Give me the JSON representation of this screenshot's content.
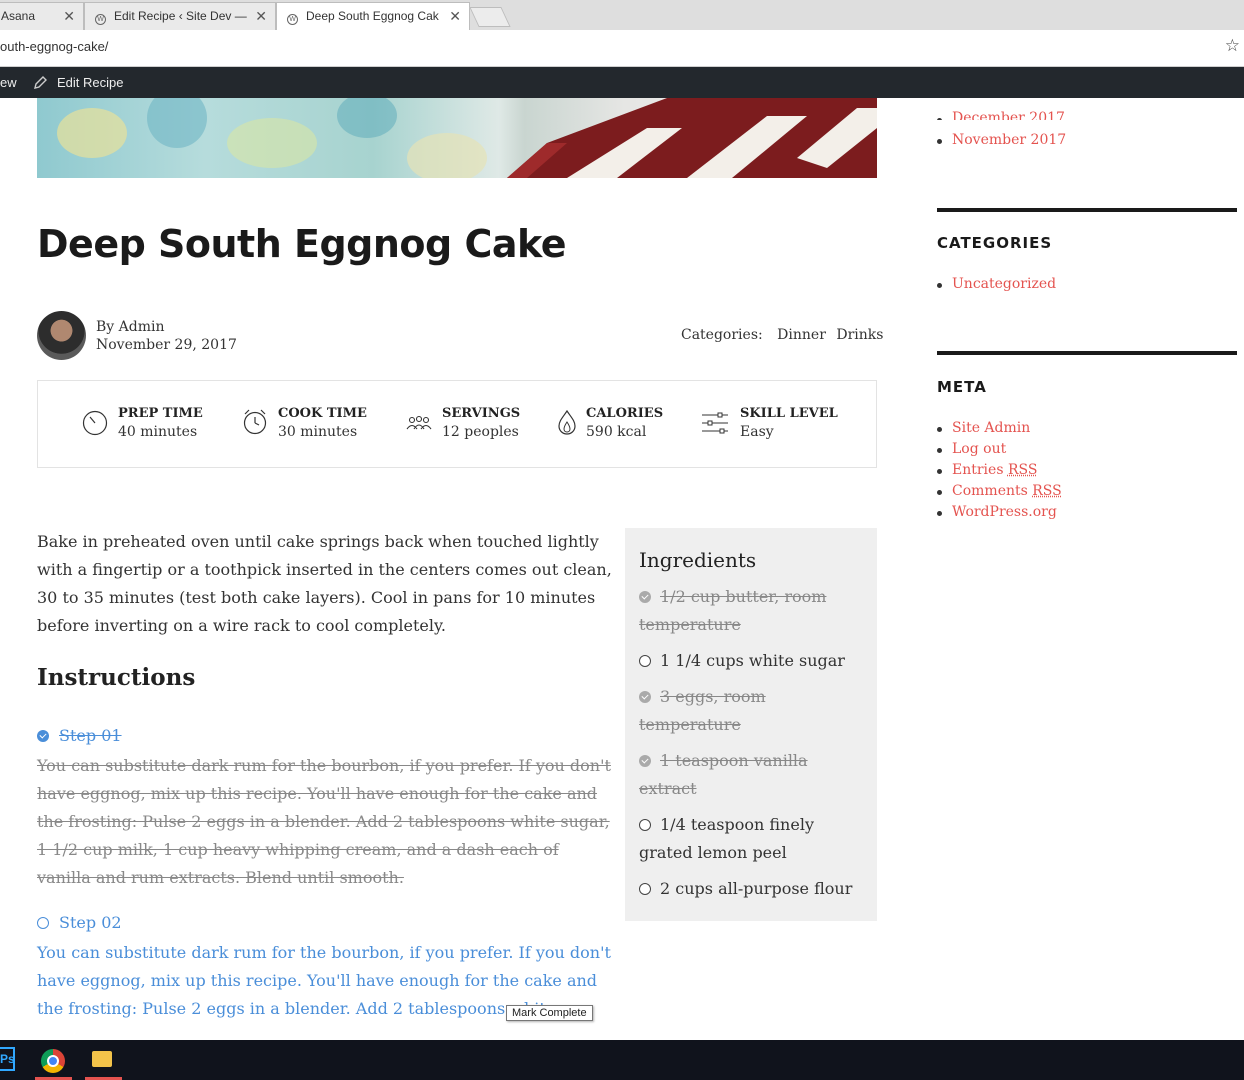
{
  "browser": {
    "tabs": [
      {
        "label": "Asana",
        "close": "✕"
      },
      {
        "label": "Edit Recipe ‹ Site Dev —",
        "close": "✕"
      },
      {
        "label": "Deep South Eggnog Cak",
        "close": "✕"
      }
    ],
    "url": "outh-eggnog-cake/",
    "star": "☆"
  },
  "adminbar": {
    "view_label": "ew",
    "edit_label": "Edit Recipe"
  },
  "post": {
    "title": "Deep South Eggnog Cake",
    "author": "By Admin",
    "date": "November 29, 2017",
    "categories_label": "Categories:",
    "categories": [
      "Dinner",
      "Drinks"
    ]
  },
  "info": [
    {
      "label": "PREP TIME",
      "value": "40 minutes",
      "icon": "timer-icon"
    },
    {
      "label": "COOK TIME",
      "value": "30 minutes",
      "icon": "alarm-clock-icon"
    },
    {
      "label": "SERVINGS",
      "value": "12 peoples",
      "icon": "people-icon"
    },
    {
      "label": "CALORIES",
      "value": "590 kcal",
      "icon": "flame-icon"
    },
    {
      "label": "SKILL LEVEL",
      "value": "Easy",
      "icon": "sliders-icon"
    }
  ],
  "intro": "Bake in preheated oven until cake springs back when touched lightly with a fingertip or a toothpick inserted in the centers comes out clean, 30 to 35 minutes (test both cake layers). Cool in pans for 10 minutes before inverting on a wire rack to cool completely.",
  "instructions": {
    "heading": "Instructions",
    "steps": [
      {
        "label": "Step 01",
        "completed": true,
        "text": "You can substitute dark rum for the bourbon, if you prefer. If you don't have eggnog, mix up this recipe. You'll have enough for the cake and the frosting: Pulse 2 eggs in a blender. Add 2 tablespoons white sugar, 1 1/2 cup milk, 1 cup heavy whipping cream, and a dash each of vanilla and rum extracts. Blend until smooth."
      },
      {
        "label": "Step 02",
        "completed": false,
        "text": "You can substitute dark rum for the bourbon, if you prefer. If you don't have eggnog, mix up this recipe. You'll have enough for the cake and the frosting: Pulse 2 eggs in a blender. Add 2 tablespoons white"
      }
    ],
    "tooltip": "Mark Complete"
  },
  "ingredients": {
    "heading": "Ingredients",
    "items": [
      {
        "text": "1/2 cup butter, room temperature",
        "completed": true
      },
      {
        "text": "1 1/4 cups white sugar",
        "completed": false
      },
      {
        "text": "3 eggs, room temperature",
        "completed": true
      },
      {
        "text": "1 teaspoon vanilla extract",
        "completed": true
      },
      {
        "text": "1/4 teaspoon finely grated lemon peel",
        "completed": false
      },
      {
        "text": "2 cups all-purpose flour",
        "completed": false
      }
    ]
  },
  "sidebar": {
    "archives": [
      "December 2017",
      "November 2017"
    ],
    "categories_heading": "CATEGORIES",
    "categories": [
      "Uncategorized"
    ],
    "meta_heading": "META",
    "meta": [
      {
        "text": "Site Admin"
      },
      {
        "text": "Log out"
      },
      {
        "text": "Entries ",
        "abbr": "RSS"
      },
      {
        "text": "Comments ",
        "abbr": "RSS"
      },
      {
        "text": "WordPress.org"
      }
    ]
  },
  "taskbar": {
    "ps_label": "Ps"
  },
  "colors": {
    "link": "#e4534f",
    "step_blue": "#4a8ed9",
    "adminbar": "#23282d"
  }
}
